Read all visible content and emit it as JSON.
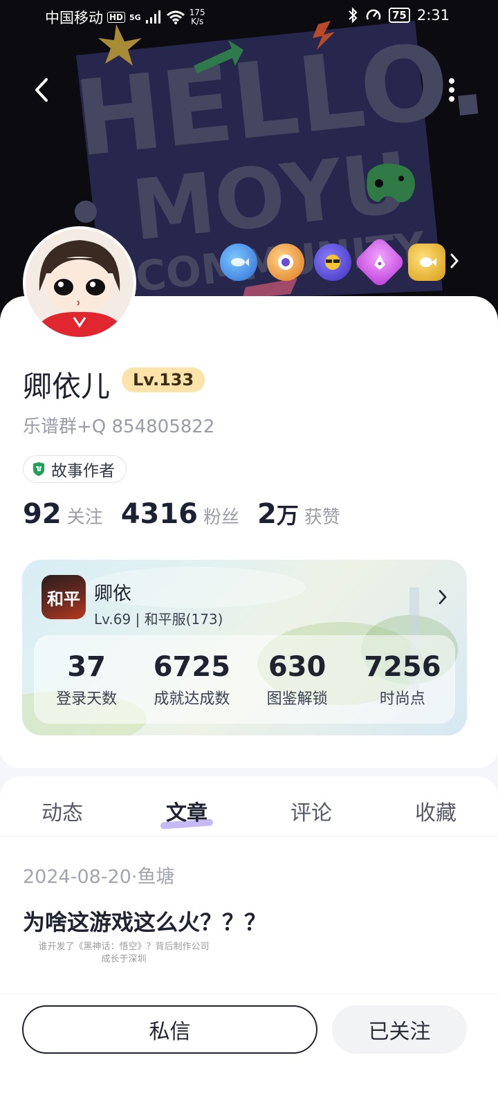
{
  "status_bar": {
    "carrier": "中国移动",
    "hd": "HD",
    "network": "5G",
    "speed_value": "175",
    "speed_unit": "K/s",
    "battery": "75",
    "time": "2:31"
  },
  "banner": {
    "line1": "HELLO.",
    "line2": "MOYU",
    "line3": "COMMUNITY"
  },
  "profile": {
    "name": "卿依儿",
    "level": "Lv.133",
    "bio": "乐谱群+Q 854805822",
    "tag": "故事作者"
  },
  "stats": {
    "following_count": "92",
    "following_label": "关注",
    "fans_count": "4316",
    "fans_label": "粉丝",
    "likes_count": "2",
    "likes_unit": "万",
    "likes_label": "获赞"
  },
  "game_card": {
    "game_icon_text": "和平",
    "role_name": "卿依",
    "role_sub": "Lv.69 | 和平服(173)",
    "items": [
      {
        "value": "37",
        "label": "登录天数"
      },
      {
        "value": "6725",
        "label": "成就达成数"
      },
      {
        "value": "630",
        "label": "图鉴解锁"
      },
      {
        "value": "7256",
        "label": "时尚点"
      }
    ]
  },
  "tabs": [
    {
      "label": "动态"
    },
    {
      "label": "文章"
    },
    {
      "label": "评论"
    },
    {
      "label": "收藏"
    }
  ],
  "active_tab": "文章",
  "post": {
    "meta": "2024-08-20·鱼塘",
    "title": "为啥这游戏这么火？？？",
    "image_line1": "谁开发了《黑神话：悟空》？背后制作公司",
    "image_line2": "成长于深圳"
  },
  "bottom": {
    "message_label": "私信",
    "follow_label": "已关注"
  },
  "colors": {
    "level_badge_bg": "#fbe3a9",
    "tab_highlight": "#b7a9f3",
    "banner_bg": "#0b0b10"
  }
}
